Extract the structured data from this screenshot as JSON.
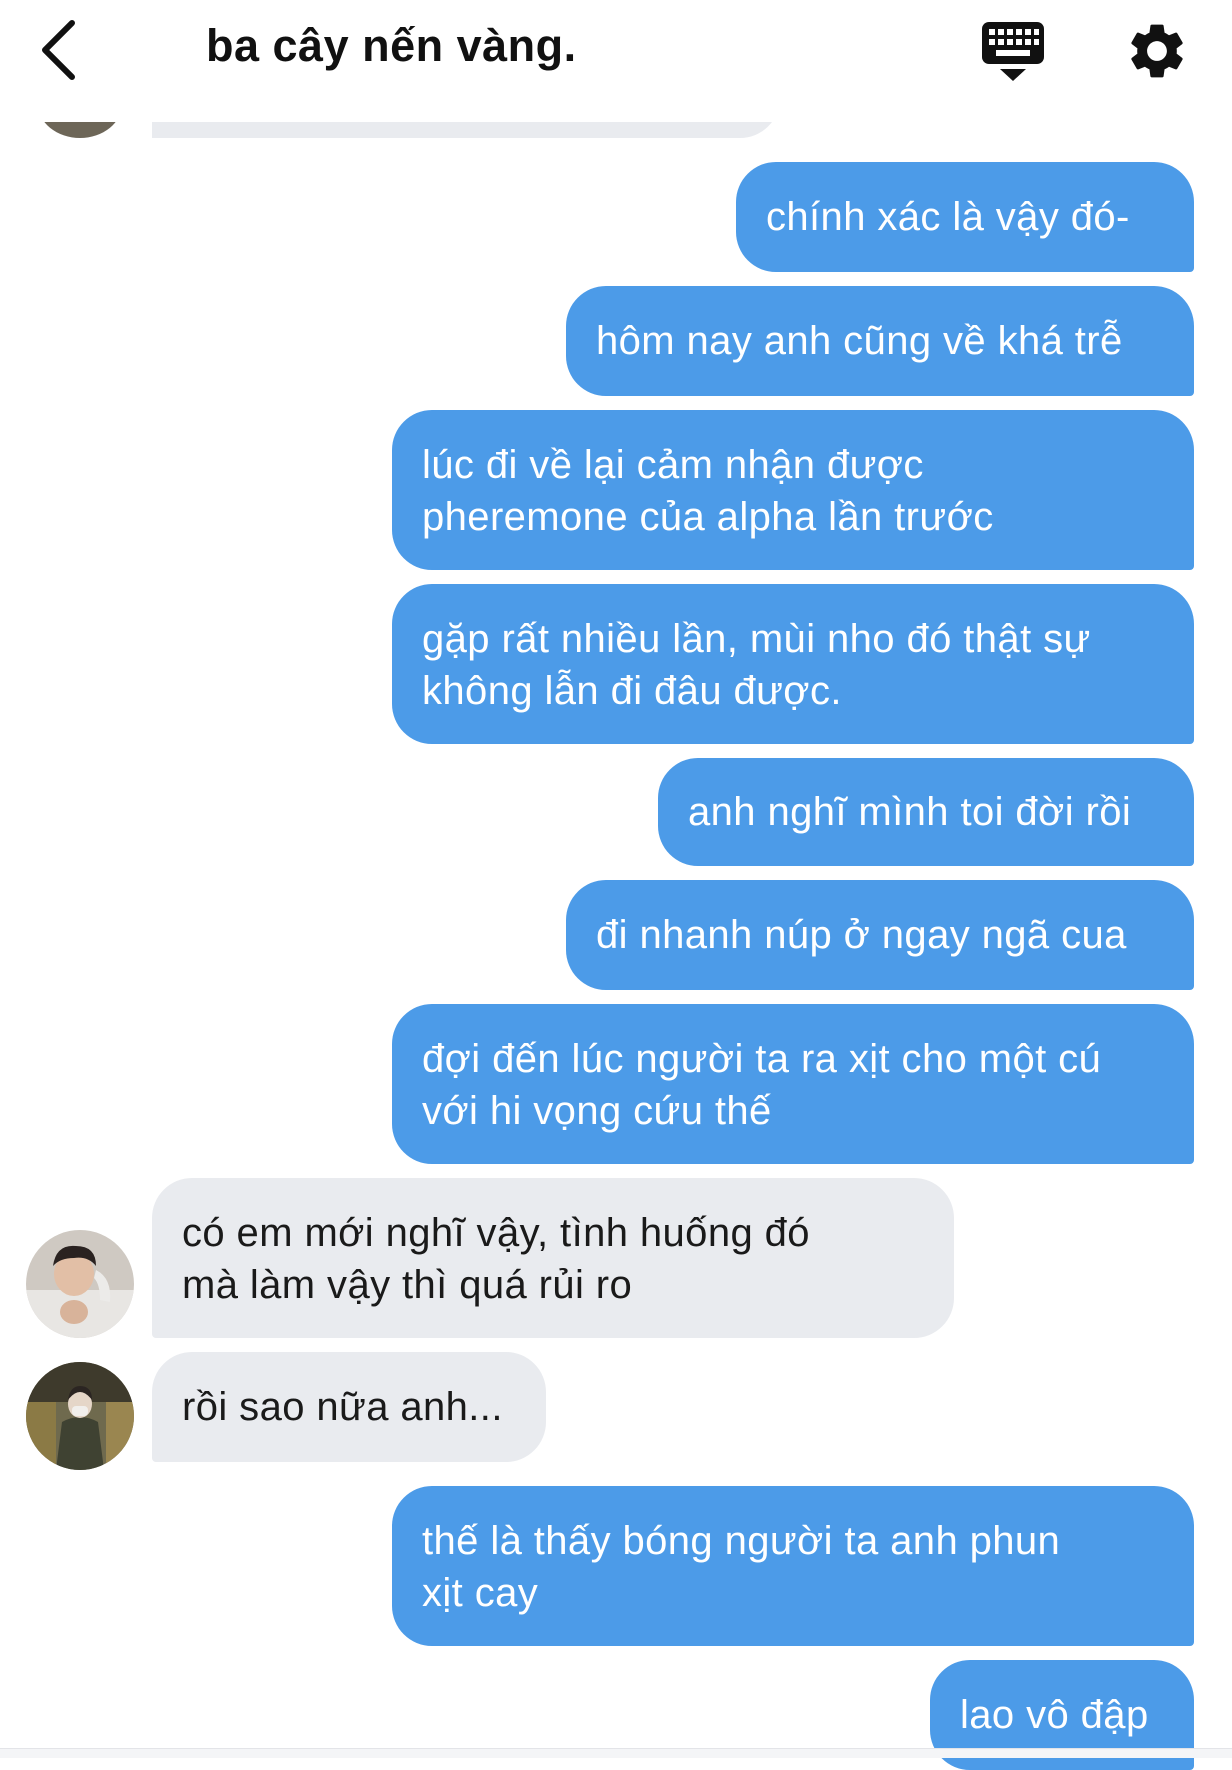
{
  "header": {
    "title": "ba cây nến vàng."
  },
  "icons": {
    "back": "chevron-left-icon",
    "keyboard": "keyboard-icon",
    "settings": "gear-icon"
  },
  "colors": {
    "outgoing_bubble": "#4c9be8",
    "incoming_bubble": "#e9ebef",
    "outgoing_text": "#ffffff",
    "incoming_text": "#1a1a1a"
  },
  "messages": [
    {
      "sender": "me",
      "text": "chính xác là vậy đó-"
    },
    {
      "sender": "me",
      "text": "hôm nay anh cũng về khá trễ"
    },
    {
      "sender": "me",
      "text": "lúc đi về lại cảm nhận được\npheremone của alpha lần trước"
    },
    {
      "sender": "me",
      "text": "gặp rất nhiều lần, mùi nho đó thật sự\nkhông lẫn đi đâu được."
    },
    {
      "sender": "me",
      "text": "anh nghĩ mình toi đời rồi"
    },
    {
      "sender": "me",
      "text": "đi nhanh núp ở ngay ngã cua"
    },
    {
      "sender": "me",
      "text": "đợi đến lúc người ta ra xịt cho một cú\nvới hi vọng cứu thế"
    },
    {
      "sender": "other_1",
      "text": "có em mới nghĩ vậy, tình huống đó\nmà làm vậy thì quá rủi ro"
    },
    {
      "sender": "other_2",
      "text": "rồi sao nữa anh..."
    },
    {
      "sender": "me",
      "text": "thế là thấy bóng người ta anh phun\nxịt cay"
    },
    {
      "sender": "me",
      "text": "lao vô đập"
    }
  ]
}
